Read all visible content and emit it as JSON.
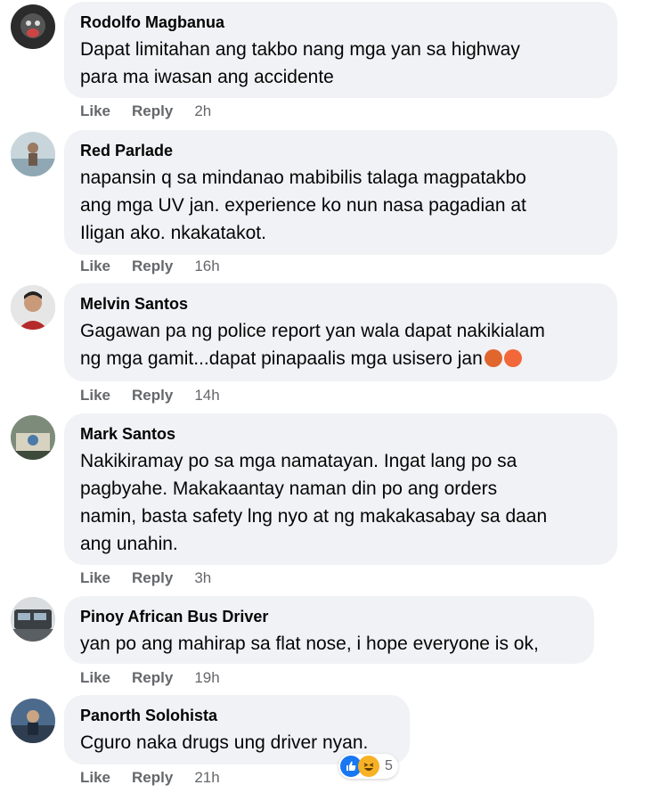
{
  "labels": {
    "like": "Like",
    "reply": "Reply"
  },
  "comments": [
    {
      "author": "Rodolfo Magbanua",
      "text": "Dapat limitahan ang takbo nang mga yan sa highway\npara ma iwasan ang accidente",
      "time": "2h",
      "avatar_color": "#3a3a3a"
    },
    {
      "author": "Red Parlade",
      "text": "napansin q sa mindanao mabibilis talaga magpatakbo\nang mga UV jan. experience ko nun nasa pagadian at\nIligan ako. nkakatakot.",
      "time": "16h",
      "avatar_color": "#b9c4c9"
    },
    {
      "author": "Melvin Santos",
      "text": "Gagawan pa ng police report yan wala dapat nakikialam\nng mga gamit...dapat pinapaalis mga usisero jan",
      "time": "14h",
      "avatar_color": "#d9d9d9",
      "emojis": [
        "cursing-face-emoji",
        "angry-face-emoji"
      ]
    },
    {
      "author": "Mark Santos",
      "text": "Nakikiramay po sa mga namatayan. Ingat lang po sa\npagbyahe. Makakaantay naman din po ang orders\nnamin, basta safety lng nyo at ng makakasabay sa daan\nang unahin.",
      "time": "3h",
      "avatar_color": "#6a7b6a"
    },
    {
      "author": "Pinoy African Bus Driver",
      "text": "yan po ang mahirap sa flat nose, i hope everyone is ok,",
      "time": "19h",
      "avatar_color": "#5a5f64"
    },
    {
      "author": "Panorth Solohista",
      "text": "Cguro naka drugs ung driver nyan.",
      "time": "21h",
      "avatar_color": "#4c6a8c",
      "reactions": {
        "icons": [
          "like-reaction-icon",
          "haha-reaction-icon"
        ],
        "count": "5"
      }
    }
  ],
  "colors": {
    "bubble": "#f0f2f5",
    "secondary_text": "#65676b",
    "like_blue": "#1877f2",
    "haha_yellow": "#f7b125"
  }
}
